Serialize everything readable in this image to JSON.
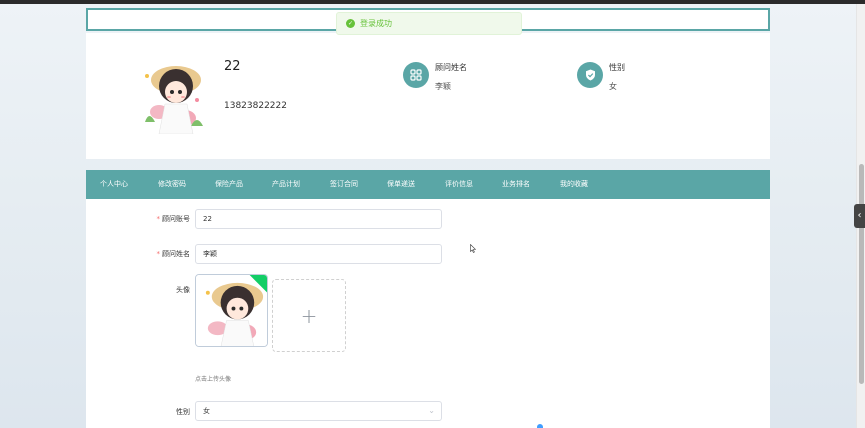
{
  "toast": {
    "message": "登录成功"
  },
  "profile": {
    "username": "22",
    "phone": "13823822222",
    "info": [
      {
        "label": "顾问姓名",
        "value": "李颖",
        "icon": "grid-icon"
      },
      {
        "label": "性别",
        "value": "女",
        "icon": "shield-check-icon"
      }
    ]
  },
  "nav": {
    "items": [
      "个人中心",
      "修改密码",
      "保险产品",
      "产品计划",
      "签订合同",
      "保单递送",
      "评价信息",
      "业务排名",
      "我的收藏"
    ]
  },
  "form": {
    "account": {
      "label": "顾问账号",
      "value": "22",
      "required": true
    },
    "name": {
      "label": "顾问姓名",
      "value": "李颖",
      "required": true
    },
    "avatar": {
      "label": "头像",
      "tip": "点击上传头像",
      "add_icon": "plus-icon"
    },
    "gender": {
      "label": "性别",
      "value": "女"
    }
  },
  "colors": {
    "accent": "#5aa6a6",
    "success": "#67c23a",
    "required": "#f56c6c"
  }
}
